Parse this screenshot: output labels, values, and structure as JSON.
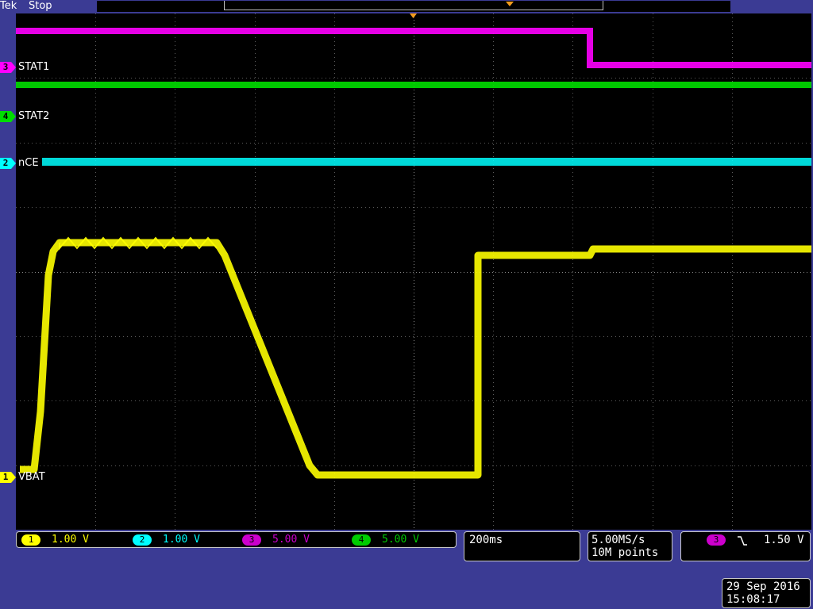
{
  "header": {
    "brand": "Tek",
    "acq_state": "Stop"
  },
  "channels": [
    {
      "id": "1",
      "label": "VBAT",
      "scale": "1.00 V",
      "color": "#ffff00"
    },
    {
      "id": "2",
      "label": "nCE",
      "scale": "1.00 V",
      "color": "#00ffff"
    },
    {
      "id": "3",
      "label": "STAT1",
      "scale": "5.00 V",
      "color": "#ff00ff"
    },
    {
      "id": "4",
      "label": "STAT2",
      "scale": "5.00 V",
      "color": "#00dd00"
    }
  ],
  "timebase": {
    "scale": "200ms"
  },
  "acquisition": {
    "sample_rate": "5.00MS/s",
    "record_length": "10M points"
  },
  "trigger": {
    "source": "3",
    "slope_icon": "falling-edge-icon",
    "level": "1.50 V"
  },
  "datetime": {
    "date": "29 Sep  2016",
    "time": "15:08:17"
  },
  "colors": {
    "background": "#3b3b94",
    "graticule": "#000000",
    "trigger_marker": "#f39c1c"
  }
}
